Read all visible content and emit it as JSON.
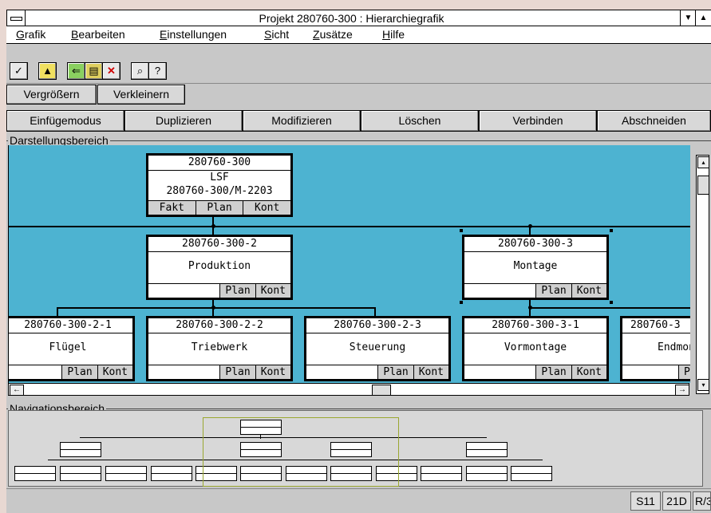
{
  "window": {
    "title": "Projekt 280760-300 : Hierarchiegrafik"
  },
  "menu": [
    "Grafik",
    "Bearbeiten",
    "Einstellungen",
    "Sicht",
    "Zusätze",
    "Hilfe"
  ],
  "toolbar_icons": [
    "check-icon",
    "open-folder-icon",
    "back-arrow-icon",
    "exit-door-icon",
    "delete-x-icon",
    "zoom-icon",
    "help-icon"
  ],
  "zoom_buttons": {
    "zoom_in": "Vergrößern",
    "zoom_out": "Verkleinern"
  },
  "mode_buttons": [
    "Einfügemodus",
    "Duplizieren",
    "Modifizieren",
    "Löschen",
    "Verbinden",
    "Abschneiden"
  ],
  "display_area": {
    "label": "Darstellungsbereich",
    "root": {
      "id": "280760-300",
      "name": "LSF",
      "sub": "280760-300/M-2203",
      "buttons": [
        "Fakt",
        "Plan",
        "Kont"
      ]
    },
    "level2": [
      {
        "id": "280760-300-2",
        "name": "Produktion",
        "buttons": [
          "Plan",
          "Kont"
        ]
      },
      {
        "id": "280760-300-3",
        "name": "Montage",
        "buttons": [
          "Plan",
          "Kont"
        ]
      }
    ],
    "level3": [
      {
        "id": "280760-300-2-1",
        "name": "Flügel",
        "buttons": [
          "Plan",
          "Kont"
        ]
      },
      {
        "id": "280760-300-2-2",
        "name": "Triebwerk",
        "buttons": [
          "Plan",
          "Kont"
        ]
      },
      {
        "id": "280760-300-2-3",
        "name": "Steuerung",
        "buttons": [
          "Plan",
          "Kont"
        ]
      },
      {
        "id": "280760-300-3-1",
        "name": "Vormontage",
        "buttons": [
          "Plan",
          "Kont"
        ]
      },
      {
        "id": "280760-3",
        "name": "Endmon",
        "buttons": [
          "Pl"
        ]
      }
    ]
  },
  "nav_area": {
    "label": "Navigationsbereich"
  },
  "status": [
    "S11",
    "21D",
    "R/3"
  ],
  "colors": {
    "canvas": "#4db3d1",
    "nav_bg": "#d8d8d8",
    "viewport": "#9aa730"
  }
}
